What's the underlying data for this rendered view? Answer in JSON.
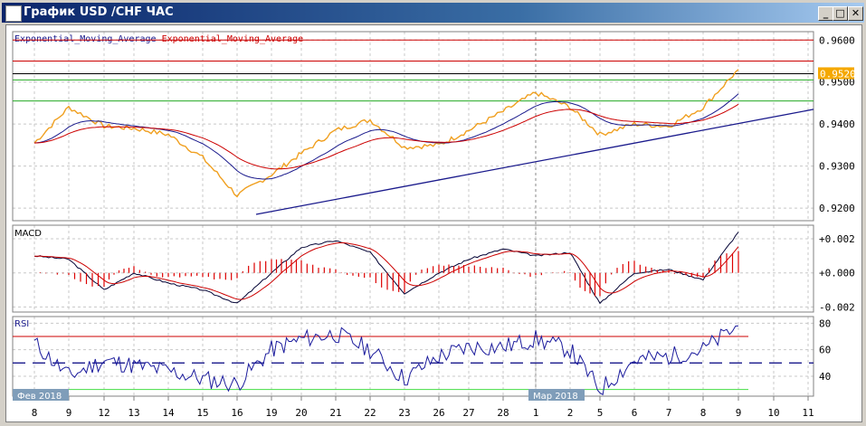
{
  "window": {
    "title": "График USD /CHF  ЧАС",
    "minimize": "_",
    "maximize": "□",
    "close": "✕"
  },
  "legend": {
    "ema1": "Exponential_Moving_Average",
    "ema2": "Exponential_Moving_Average",
    "ema1_color": "#1a1a8c",
    "ema2_color": "#cc0000"
  },
  "price_axis": {
    "ticks": [
      "0.9600",
      "0.9500",
      "0.9400",
      "0.9300",
      "0.9200"
    ],
    "current": "0.9520",
    "current_color": "#f5a800"
  },
  "macd": {
    "label": "MACD",
    "ticks": [
      "+0.002",
      "+0.000",
      "-0.002"
    ]
  },
  "rsi": {
    "label": "RSI",
    "ticks": [
      "80",
      "60",
      "40"
    ],
    "levels": [
      70,
      50,
      30
    ]
  },
  "x_axis": {
    "labels": [
      "8",
      "9",
      "12",
      "13",
      "14",
      "15",
      "16",
      "19",
      "20",
      "21",
      "22",
      "23",
      "26",
      "27",
      "28",
      "1",
      "2",
      "5",
      "6",
      "7",
      "8",
      "9",
      "10",
      "11"
    ],
    "month_labels": [
      "Фев 2018",
      "Мар 2018"
    ]
  },
  "chart_data": {
    "type": "line",
    "title": "График USD /CHF  ЧАС",
    "x": [
      "8",
      "9",
      "12",
      "13",
      "14",
      "15",
      "16",
      "19",
      "20",
      "21",
      "22",
      "23",
      "26",
      "27",
      "28",
      "1",
      "2",
      "5",
      "6",
      "7",
      "8",
      "9"
    ],
    "price": [
      0.9355,
      0.944,
      0.9395,
      0.939,
      0.9375,
      0.932,
      0.923,
      0.928,
      0.933,
      0.9385,
      0.941,
      0.9345,
      0.935,
      0.9385,
      0.943,
      0.9475,
      0.944,
      0.9375,
      0.94,
      0.9395,
      0.944,
      0.953
    ],
    "macd": [
      0.001,
      0.0008,
      -0.001,
      0.0,
      -0.0006,
      -0.001,
      -0.0018,
      0.0,
      0.0015,
      0.0019,
      0.0012,
      -0.0012,
      0.0,
      0.0008,
      0.0014,
      0.001,
      0.0012,
      -0.0018,
      0.0,
      0.0002,
      -0.0004,
      0.0024
    ],
    "rsi": [
      65,
      40,
      52,
      48,
      44,
      38,
      34,
      60,
      68,
      72,
      60,
      38,
      55,
      62,
      62,
      68,
      60,
      30,
      52,
      55,
      60,
      78
    ],
    "horizontal_levels": {
      "red": [
        0.96,
        0.955
      ],
      "black": [
        0.952
      ],
      "green": [
        0.9505,
        0.9455
      ]
    },
    "trendline": {
      "from": [
        "16",
        0.9185
      ],
      "to": [
        "11",
        0.9435
      ]
    },
    "ylim": [
      0.917,
      0.962
    ],
    "macd_ylim": [
      -0.0023,
      0.0028
    ],
    "rsi_ylim": [
      25,
      85
    ]
  }
}
